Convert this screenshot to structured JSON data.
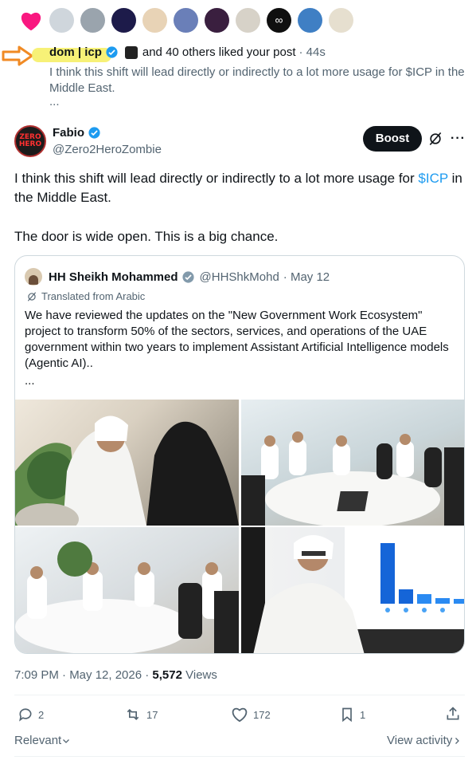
{
  "notification": {
    "liker_name": "dom | icp",
    "liked_text": "and 40 others liked your post",
    "time": "· 44s",
    "post_preview": "I think this shift will lead directly or indirectly to a lot more usage for $ICP in the Middle East.",
    "ellipsis": "...",
    "avatar_colors": [
      "#cfd6dc",
      "#9aa4ad",
      "#1d1b4a",
      "#e8d3b6",
      "#6a7fb8",
      "#3a1f3f",
      "#d7d2c8",
      "#0f0f0f",
      "#3f7fc4",
      "#e6dfcf"
    ]
  },
  "tweet": {
    "author_name": "Fabio",
    "author_handle": "@Zero2HeroZombie",
    "avatar_text_1": "ZERO",
    "avatar_text_2": "HERO",
    "boost_label": "Boost",
    "text_before": "I think this shift will lead directly or indirectly to a lot more usage for ",
    "cashtag": "$ICP",
    "text_after": " in the Middle East.",
    "text_line2": "The door is wide open. This is a big chance."
  },
  "quote": {
    "name": "HH Sheikh Mohammed",
    "handle": "@HHShkMohd",
    "date": "· May 12",
    "translated": "Translated from Arabic",
    "text": "We have reviewed the updates on the \"New Government Work Ecosystem\" project to transform 50% of the sectors, services, and operations of the UAE government within two years to implement Assistant Artificial Intelligence models (Agentic AI)..",
    "ellipsis": "..."
  },
  "meta": {
    "timestamp": "7:09 PM · May 12, 2026 · ",
    "views_count": "5,572",
    "views_label": " Views"
  },
  "actions": {
    "replies": "2",
    "reposts": "17",
    "likes": "172",
    "bookmarks": "1"
  },
  "footer": {
    "relevant": "Relevant",
    "view_activity": "View activity"
  },
  "colors": {
    "accent": "#1d9bf0",
    "heart": "#f91880",
    "arrow": "#f08a24"
  }
}
